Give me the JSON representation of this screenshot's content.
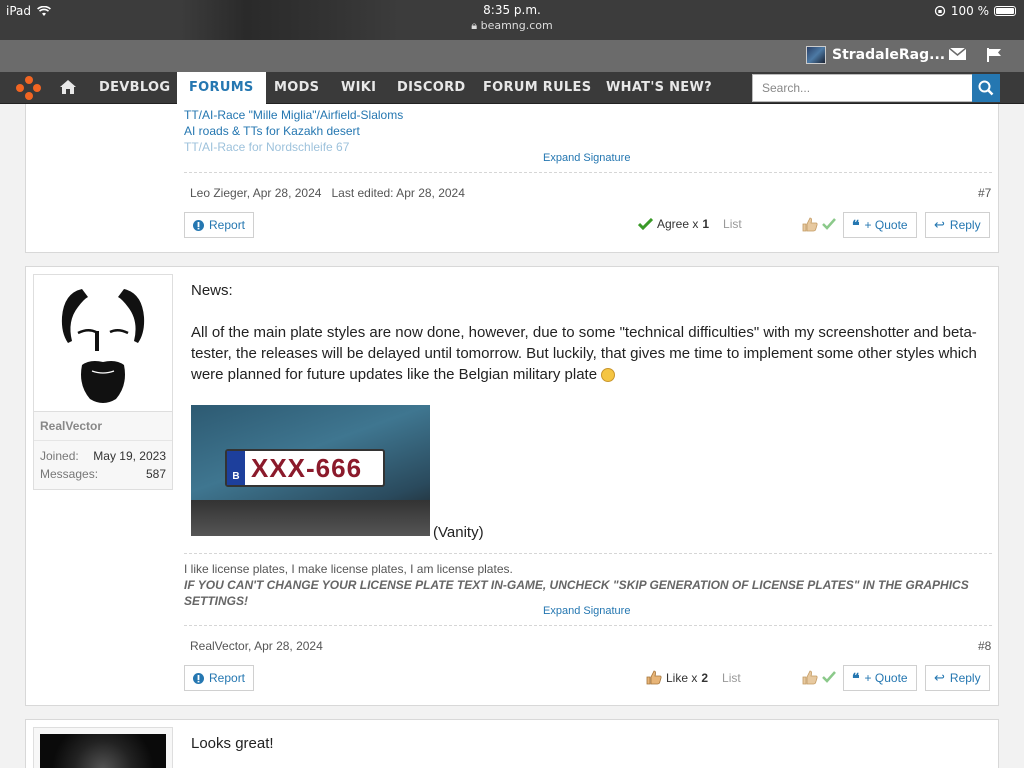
{
  "status": {
    "device": "iPad",
    "time": "8:35 p.m.",
    "url": "beamng.com",
    "battery": "100 %"
  },
  "userbar": {
    "username": "StradaleRag..."
  },
  "nav": {
    "items": [
      "DEVBLOG",
      "FORUMS",
      "MODS",
      "WIKI",
      "DISCORD",
      "FORUM RULES",
      "WHAT'S NEW?"
    ],
    "active": "FORUMS",
    "search_placeholder": "Search..."
  },
  "post7": {
    "signature_links": [
      "TT/AI-Race \"Mille Miglia\"/Airfield-Slaloms",
      "AI roads & TTs for Kazakh desert",
      "TT/AI-Race for Nordschleife 67"
    ],
    "expand": "Expand Signature",
    "author": "Leo Zieger",
    "date": "Apr 28, 2024",
    "edited": "Last edited: Apr 28, 2024",
    "number": "#7",
    "report": "Report",
    "reaction": "Agree x",
    "reaction_count": "1",
    "list": "List",
    "quote": "+ Quote",
    "reply": "Reply"
  },
  "post8": {
    "username": "RealVector",
    "joined_label": "Joined:",
    "joined": "May 19, 2023",
    "messages_label": "Messages:",
    "messages": "587",
    "line1": "News:",
    "body": "All of the main plate styles are now done, however, due to some \"technical difficulties\" with my screenshotter and beta-tester, the releases will be delayed until tomorrow. But luckily, that gives me time to implement some other styles which were planned for future updates like the Belgian military plate",
    "plate_text": "XXX-666",
    "plate_country": "B",
    "caption": "(Vanity)",
    "sig1": "I like license plates, I make license plates, I am license plates.",
    "sig2": "IF YOU CAN'T CHANGE YOUR LICENSE PLATE TEXT IN-GAME, UNCHECK \"SKIP GENERATION OF LICENSE PLATES\" IN THE GRAPHICS SETTINGS!",
    "expand": "Expand Signature",
    "author": "RealVector",
    "date": "Apr 28, 2024",
    "number": "#8",
    "report": "Report",
    "reaction": "Like x",
    "reaction_count": "2",
    "list": "List",
    "quote": "+ Quote",
    "reply": "Reply"
  },
  "post9": {
    "body": "Looks great!"
  }
}
